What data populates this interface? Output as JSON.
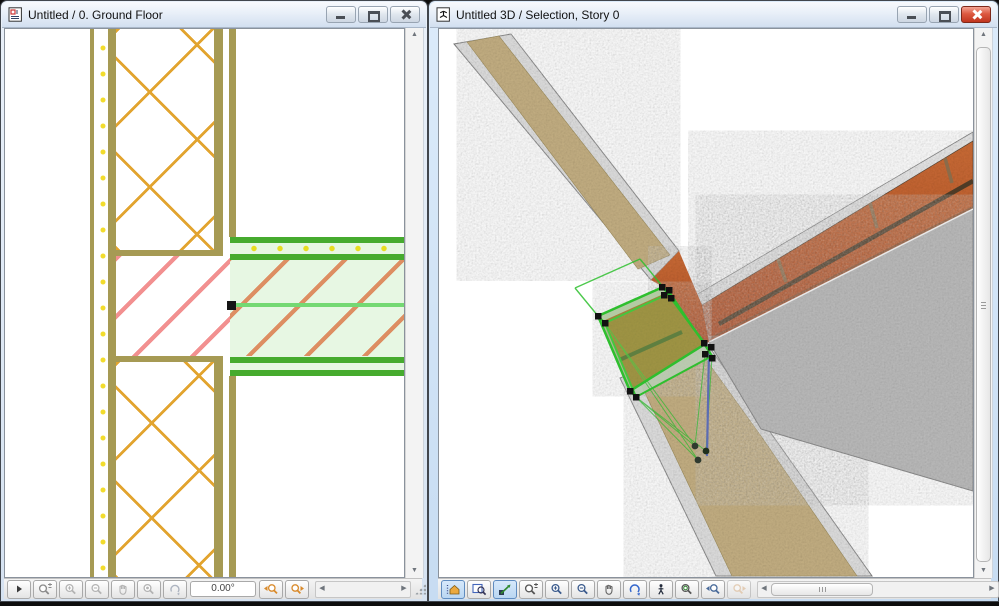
{
  "left_window": {
    "title": "Untitled / 0. Ground Floor",
    "window_buttons": [
      "minimize",
      "maximize",
      "close"
    ],
    "active": false,
    "toolbar": {
      "angle_value": "0.00°",
      "buttons": [
        "flyout",
        "zoom-combined",
        "zoom-in",
        "zoom-out",
        "pan",
        "fit-in-window",
        "rotate-view",
        "rotation-angle-field",
        "previous-zoom",
        "next-zoom"
      ],
      "disabled_buttons": [
        "zoom-in",
        "zoom-out",
        "pan",
        "fit-in-window",
        "rotate-view"
      ]
    },
    "drawing": {
      "type": "2d-section-floor-plan",
      "selected_element": "slab",
      "wall_insulation_hatch_color": "#E2A42F",
      "wall_line_color": "#A69A54",
      "slab_hatch_color": "#F29090",
      "selected_slab_hatch_color": "#DD8E62",
      "selection_fill_color": "#E7F7E3",
      "selection_edge_color": "#46AB2E",
      "membrane_dot_color": "#F2DC2C",
      "selection_handle_color": "#151515",
      "reference_line_color": "#74D973"
    }
  },
  "right_window": {
    "title": "Untitled 3D / Selection, Story 0",
    "window_buttons": [
      "minimize",
      "maximize",
      "close"
    ],
    "active": true,
    "toolbar": {
      "buttons": [
        "projection-settings",
        "zoom-window",
        "navigation-mode",
        "zoom-combined",
        "zoom-in",
        "zoom-out",
        "pan",
        "orbit",
        "explore",
        "fit-in-window",
        "previous-view",
        "next-view"
      ],
      "selected_buttons": [
        "projection-settings",
        "navigation-mode"
      ],
      "disabled_buttons": [
        "next-view"
      ]
    },
    "scene": {
      "type": "3d-perspective-view",
      "selected_element": "slab",
      "wall_plaster_color": "#C6B184",
      "wall_edge_color": "#DBDBDB",
      "slab_brick_color": "#C2602F",
      "slab_concrete_color": "#BDBDBD",
      "selection_wire_color": "#2EBF2E",
      "selection_handle_color": "#111111",
      "selected_edge_color": "#5C6CB4"
    }
  }
}
